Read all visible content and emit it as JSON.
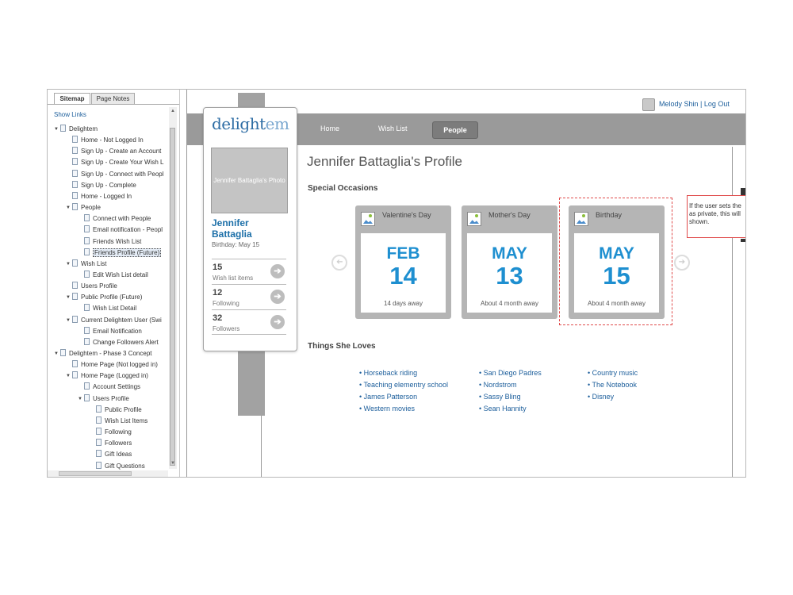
{
  "sitemap": {
    "tabs": [
      "Sitemap",
      "Page Notes"
    ],
    "show_links": "Show Links",
    "tree": [
      {
        "label": "Delightem",
        "level": 0,
        "toggle": true
      },
      {
        "label": "Home - Not Logged In",
        "level": 1
      },
      {
        "label": "Sign Up - Create an Account",
        "level": 1
      },
      {
        "label": "Sign Up - Create Your Wish L",
        "level": 1
      },
      {
        "label": "Sign Up - Connect with Peopl",
        "level": 1
      },
      {
        "label": "Sign Up - Complete",
        "level": 1
      },
      {
        "label": "Home - Logged In",
        "level": 1
      },
      {
        "label": "People",
        "level": 1,
        "toggle": true
      },
      {
        "label": "Connect with People",
        "level": 2
      },
      {
        "label": "Email notification - Peopl",
        "level": 2
      },
      {
        "label": "Friends Wish List",
        "level": 2
      },
      {
        "label": "Friends Profile (Future)",
        "level": 2,
        "selected": true
      },
      {
        "label": "Wish List",
        "level": 1,
        "toggle": true
      },
      {
        "label": "Edit Wish List detail",
        "level": 2
      },
      {
        "label": "Users Profile",
        "level": 1
      },
      {
        "label": "Public Profile (Future)",
        "level": 1,
        "toggle": true
      },
      {
        "label": "Wish List Detail",
        "level": 2
      },
      {
        "label": "Current Delightem User (Swi",
        "level": 1,
        "toggle": true
      },
      {
        "label": "Email Notification",
        "level": 2
      },
      {
        "label": "Change Followers Alert",
        "level": 2
      },
      {
        "label": "Delightem - Phase 3 Concept",
        "level": 0,
        "toggle": true
      },
      {
        "label": "Home Page (Not logged in)",
        "level": 1
      },
      {
        "label": "Home Page (Logged in)",
        "level": 1,
        "toggle": true
      },
      {
        "label": "Account Settings",
        "level": 2
      },
      {
        "label": "Users Profile",
        "level": 2,
        "toggle": true
      },
      {
        "label": "Public Profile",
        "level": 3
      },
      {
        "label": "Wish List Items",
        "level": 3
      },
      {
        "label": "Following",
        "level": 3
      },
      {
        "label": "Followers",
        "level": 3
      },
      {
        "label": "Gift Ideas",
        "level": 3
      },
      {
        "label": "Gift Questions",
        "level": 3
      }
    ]
  },
  "header": {
    "user": "Melody Shin | Log Out",
    "nav": {
      "home": "Home",
      "wish_list": "Wish List",
      "people": "People"
    }
  },
  "sidebar": {
    "logo": {
      "main": "delight",
      "accent": "em"
    },
    "photo_placeholder": "Jennifer Battaglia's Photo",
    "name": "Jennifer Battaglia",
    "birthday": "Birthday: May 15",
    "stats": [
      {
        "value": "15",
        "label": "Wish list items"
      },
      {
        "value": "12",
        "label": "Following"
      },
      {
        "value": "32",
        "label": "Followers"
      }
    ],
    "go_icon": "➔"
  },
  "profile": {
    "title": "Jennifer Battaglia's Profile",
    "occasions_heading": "Special Occasions",
    "occasions": [
      {
        "name": "Valentine's Day",
        "month": "FEB",
        "day": "14",
        "away": "14 days away"
      },
      {
        "name": "Mother's Day",
        "month": "MAY",
        "day": "13",
        "away": "About 4 month away"
      },
      {
        "name": "Birthday",
        "month": "MAY",
        "day": "15",
        "away": "About 4 month away"
      }
    ],
    "note": "If the user sets the\nas private, this will\nshown.",
    "loves_heading": "Things She Loves",
    "loves": [
      [
        "• Horseback riding",
        "• Teaching elementry school",
        "• James Patterson",
        "• Western movies"
      ],
      [
        "• San Diego Padres",
        "• Nordstrom",
        "• Sassy Bling",
        "• Sean Hannity"
      ],
      [
        "• Country music",
        "• The Notebook",
        "• Disney"
      ]
    ],
    "arrow_left": "➔",
    "arrow_right": "➔"
  }
}
